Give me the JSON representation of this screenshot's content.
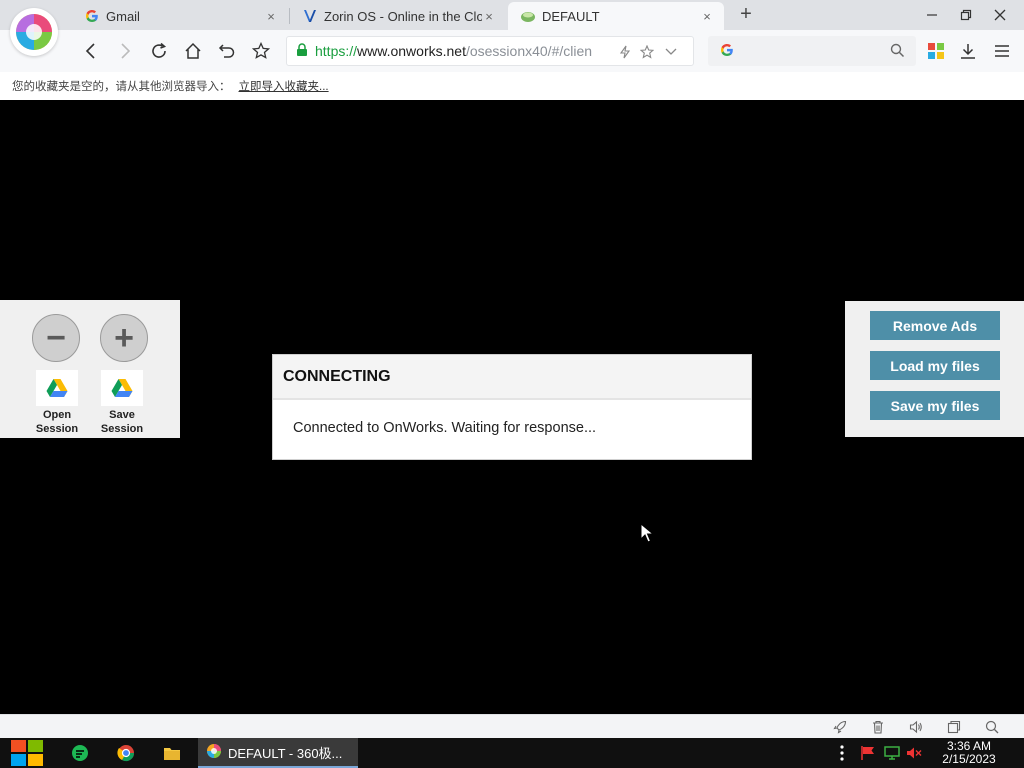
{
  "browser": {
    "tabs": [
      {
        "label": "Gmail",
        "icon": "google-g-icon"
      },
      {
        "label": "Zorin OS - Online in the Cloud",
        "icon": "onworks-icon"
      },
      {
        "label": "DEFAULT",
        "icon": "leaf-icon",
        "active": true
      }
    ],
    "close_glyph": "×",
    "url": {
      "scheme": "https://",
      "host": "www.onworks.net",
      "path": "/osessionx40/#/clien"
    },
    "bookmark_bar": {
      "empty_message": "您的收藏夹是空的，请从其他浏览器导入：",
      "import_link": "立即导入收藏夹..."
    }
  },
  "page": {
    "left_panel": {
      "zoom_out_glyph": "−",
      "zoom_in_glyph": "+",
      "open_session": {
        "line1": "Open",
        "line2": "Session"
      },
      "save_session": {
        "line1": "Save",
        "line2": "Session"
      }
    },
    "right_panel": {
      "remove_ads": "Remove Ads",
      "load_files": "Load my files",
      "save_files": "Save my files"
    },
    "dialog": {
      "title": "CONNECTING",
      "message": "Connected to OnWorks. Waiting for response..."
    }
  },
  "taskbar": {
    "active_task": "DEFAULT - 360极...",
    "time": "3:36 AM",
    "date": "2/15/2023"
  },
  "colors": {
    "accent_button": "#4e8fa8",
    "url_secure": "#1a9e3f",
    "page_background": "#000000"
  }
}
